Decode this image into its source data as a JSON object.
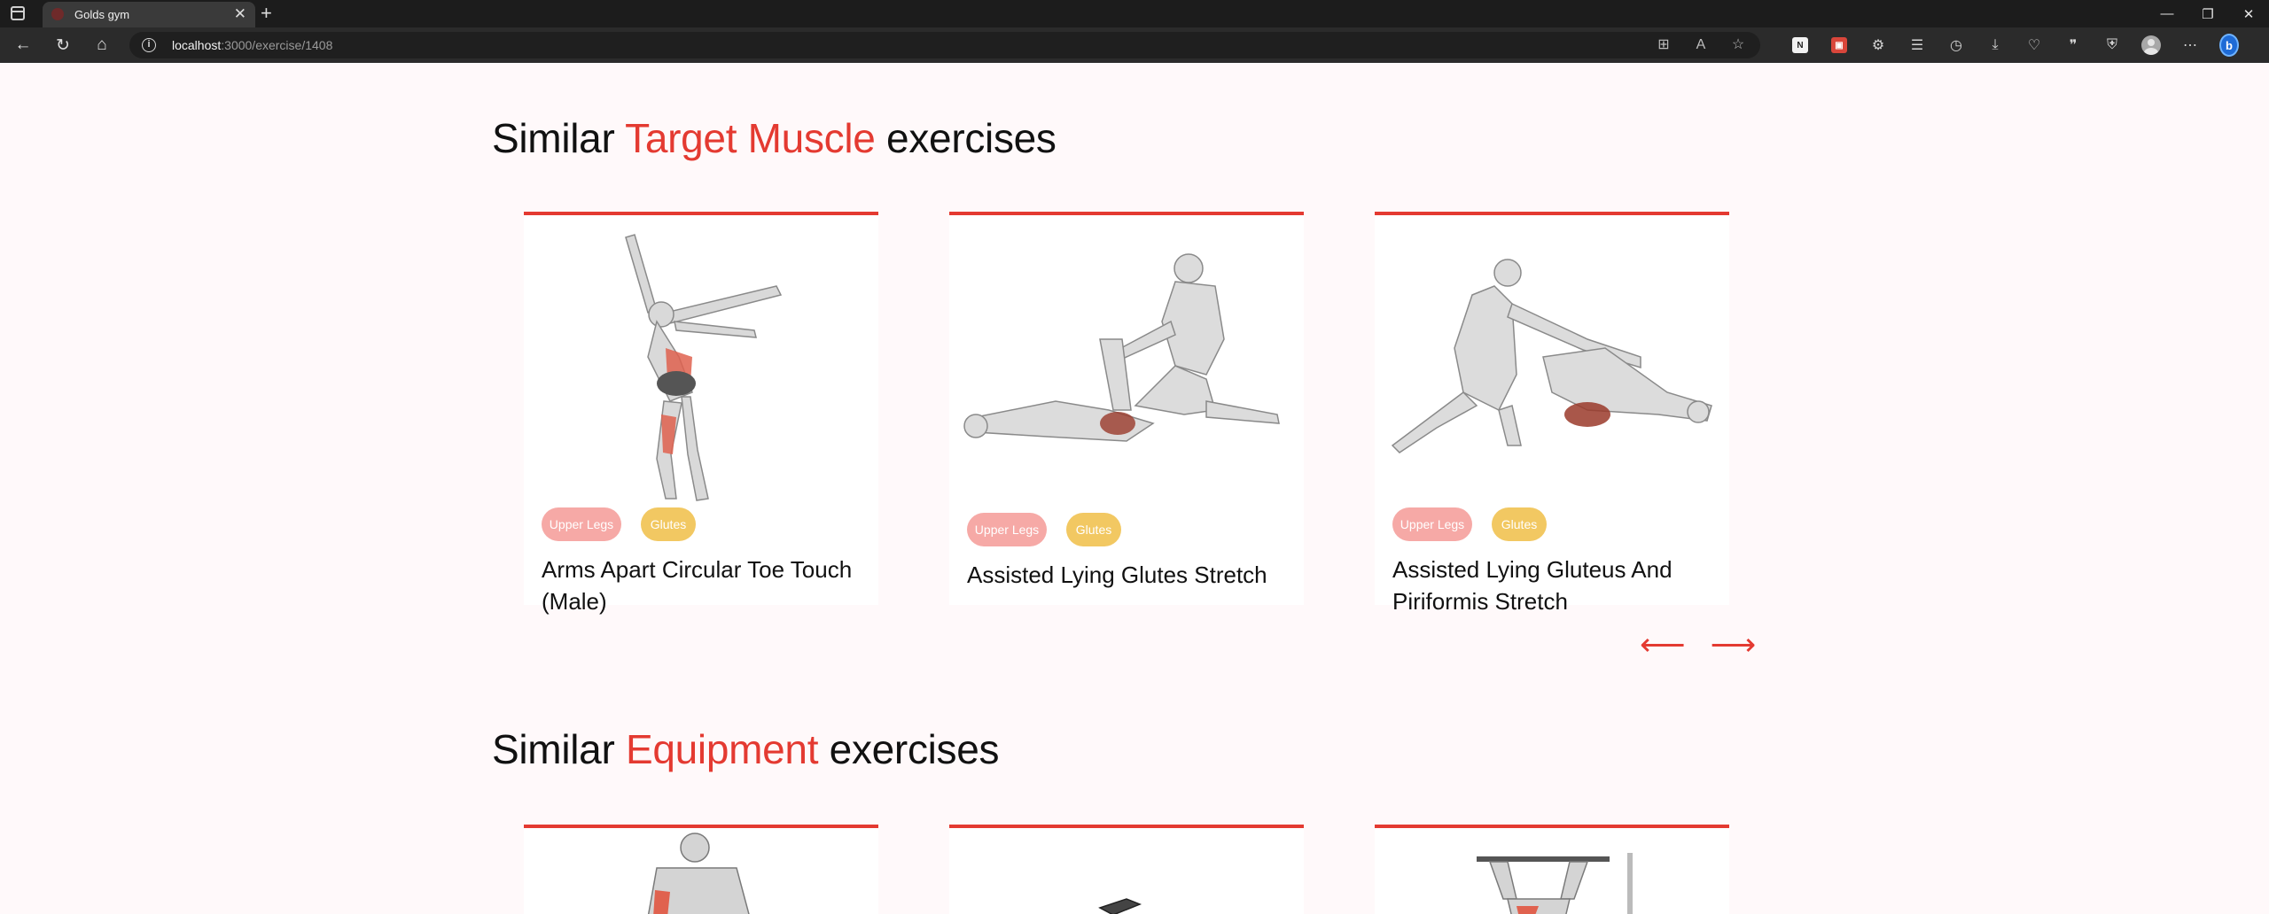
{
  "browser": {
    "tab_title": "Golds gym",
    "url_host": "localhost",
    "url_path": ":3000/exercise/1408"
  },
  "target_section": {
    "title_prefix": "Similar",
    "title_accent": "Target Muscle",
    "title_suffix": "exercises",
    "cards": [
      {
        "body_part": "Upper Legs",
        "target": "Glutes",
        "name": "Arms Apart Circular Toe Touch (Male)"
      },
      {
        "body_part": "Upper Legs",
        "target": "Glutes",
        "name": "Assisted Lying Glutes Stretch"
      },
      {
        "body_part": "Upper Legs",
        "target": "Glutes",
        "name": "Assisted Lying Gluteus And Piriformis Stretch"
      }
    ]
  },
  "equipment_section": {
    "title_prefix": "Similar",
    "title_accent": "Equipment",
    "title_suffix": "exercises"
  },
  "colors": {
    "accent": "#e43a31",
    "body_part_pill": "#f6a9a6",
    "target_pill": "#f2c862",
    "page_bg": "#fff9fa"
  },
  "icons": {
    "prev_arrow": "arrow-left-icon",
    "next_arrow": "arrow-right-icon"
  }
}
